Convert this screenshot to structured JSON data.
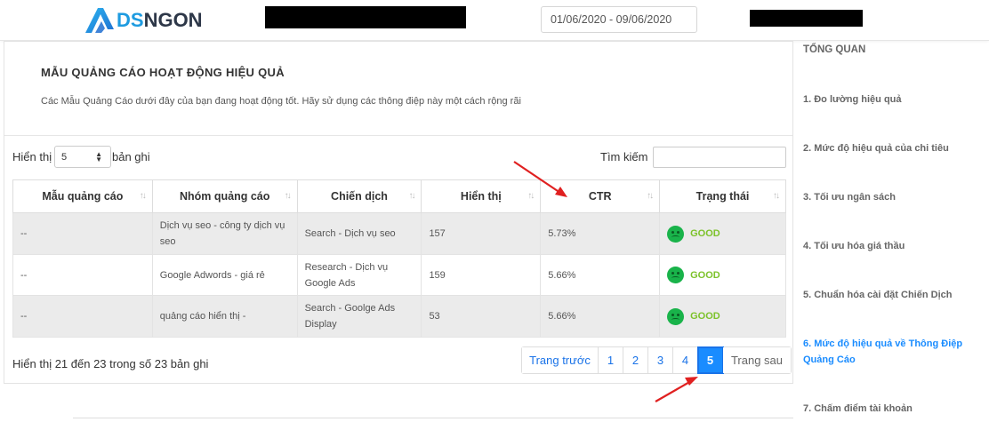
{
  "header": {
    "logo_ds": "DS",
    "logo_ngon": "NGON",
    "date_range": "01/06/2020 - 09/06/2020"
  },
  "card": {
    "title": "MẪU QUẢNG CÁO HOẠT ĐỘNG HIỆU QUẢ",
    "subtitle": "Các Mẫu Quảng Cáo dưới đây của bạn đang hoạt động tốt. Hãy sử dụng các thông điệp này một cách rộng rãi"
  },
  "controls": {
    "show_label": "Hiển thị",
    "page_size": "5",
    "show_unit": "bản ghi",
    "search_label": "Tìm kiếm",
    "search_value": ""
  },
  "table": {
    "columns": [
      "Mẫu quảng cáo",
      "Nhóm quảng cáo",
      "Chiến dịch",
      "Hiển thị",
      "CTR",
      "Trạng thái"
    ],
    "rows": [
      {
        "ad": "--",
        "group": "Dịch vụ seo - công ty dịch vụ seo",
        "campaign": "Search - Dịch vụ seo",
        "impressions": "157",
        "ctr": "5.73%",
        "status": "GOOD"
      },
      {
        "ad": "--",
        "group": "Google Adwords - giá rẻ",
        "campaign": "Research - Dịch vụ Google Ads",
        "impressions": "159",
        "ctr": "5.66%",
        "status": "GOOD"
      },
      {
        "ad": "--",
        "group": "quảng cáo hiển thị -",
        "campaign": "Search - Goolge Ads Display",
        "impressions": "53",
        "ctr": "5.66%",
        "status": "GOOD"
      }
    ]
  },
  "footer": {
    "info": "Hiển thị 21 đến 23 trong số 23 bản ghi",
    "prev": "Trang trước",
    "pages": [
      "1",
      "2",
      "3",
      "4",
      "5"
    ],
    "active_page": "5",
    "next": "Trang sau"
  },
  "sidebar": {
    "title": "TỔNG QUAN",
    "items": [
      "1. Đo lường hiệu quả",
      "2. Mức độ hiệu quả của chi tiêu",
      "3. Tối ưu ngân sách",
      "4. Tối ưu hóa giá thầu",
      "5. Chuẩn hóa cài đặt Chiến Dịch",
      "6. Mức độ hiệu quả về Thông Điệp Quảng Cáo",
      "7. Chấm điểm tài khoản"
    ],
    "active_index": 5
  },
  "colors": {
    "accent": "#1a8cff",
    "good": "#7cc22a",
    "annotation_arrow": "#e02020"
  }
}
